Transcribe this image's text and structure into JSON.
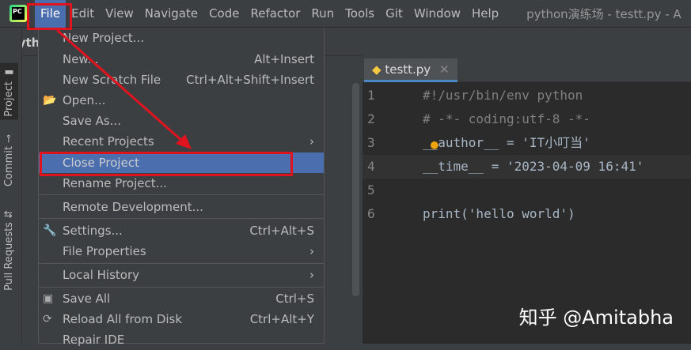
{
  "menubar": {
    "logo": "PC",
    "items": [
      "File",
      "Edit",
      "View",
      "Navigate",
      "Code",
      "Refactor",
      "Run",
      "Tools",
      "Git",
      "Window",
      "Help"
    ],
    "title": "python演练场 - testt.py - A"
  },
  "nav": {
    "project": "pyth"
  },
  "stripe": {
    "project": "Project",
    "commit": "Commit",
    "pull_requests": "Pull Requests"
  },
  "editor": {
    "tab": "testt.py",
    "lines": [
      {
        "n": "1",
        "code": "#!/usr/bin/env python"
      },
      {
        "n": "2",
        "code": "# -*- coding:utf-8 -*-"
      },
      {
        "n": "3",
        "code": "__author__ = 'IT小叮当'"
      },
      {
        "n": "4",
        "code": "__time__ = '2023-04-09 16:41'"
      },
      {
        "n": "5",
        "code": ""
      },
      {
        "n": "6",
        "code": "print('hello world')"
      }
    ]
  },
  "file_menu": {
    "items": [
      {
        "label": "New Project...",
        "shortcut": ""
      },
      {
        "label": "New...",
        "shortcut": "Alt+Insert"
      },
      {
        "label": "New Scratch File",
        "shortcut": "Ctrl+Alt+Shift+Insert"
      },
      {
        "label": "Open...",
        "shortcut": ""
      },
      {
        "label": "Save As...",
        "shortcut": ""
      },
      {
        "label": "Recent Projects",
        "shortcut": "›"
      },
      {
        "label": "Close Project",
        "shortcut": ""
      },
      {
        "label": "Rename Project...",
        "shortcut": ""
      },
      {
        "label": "Remote Development...",
        "shortcut": ""
      },
      {
        "label": "Settings...",
        "shortcut": "Ctrl+Alt+S"
      },
      {
        "label": "File Properties",
        "shortcut": "›"
      },
      {
        "label": "Local History",
        "shortcut": "›"
      },
      {
        "label": "Save All",
        "shortcut": "Ctrl+S"
      },
      {
        "label": "Reload All from Disk",
        "shortcut": "Ctrl+Alt+Y"
      },
      {
        "label": "Repair IDE",
        "shortcut": ""
      }
    ]
  },
  "watermark": "知乎 @Amitabha",
  "colors": {
    "accent": "#4b6eaf",
    "annotation": "#e0141e"
  }
}
